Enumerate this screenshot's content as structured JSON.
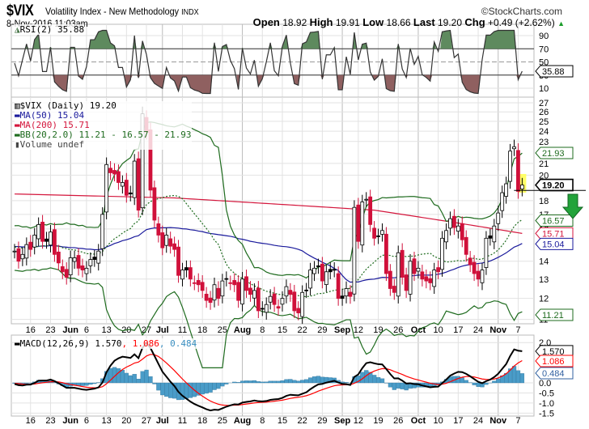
{
  "header": {
    "symbol": "$VIX",
    "name": "Volatility Index - New Methodology",
    "exchange": "INDX",
    "copyright": "©StockCharts.com",
    "datetime": "8-Nov-2016 11:03am",
    "open_label": "Open",
    "open": "18.92",
    "high_label": "High",
    "high": "19.91",
    "low_label": "Low",
    "low": "18.66",
    "last_label": "Last",
    "last": "19.20",
    "chg_label": "Chg",
    "chg": "+0.49 (+2.62%)",
    "chg_arrow": "▲"
  },
  "legends": {
    "rsi": "RSI(2) 35.88",
    "price": "$VIX (Daily) 19.20",
    "ma50": "MA(50) 15.04",
    "ma200": "MA(200) 15.71",
    "bb": "BB(20,2.0) 11.21 - 16.57 - 21.93",
    "volume": "Volume undef",
    "macd": "MACD(12,26,9) 1.570",
    "macd_signal": ", 1.086",
    "macd_hist": ", 0.484"
  },
  "colors": {
    "up": "#ffffff",
    "down": "#d0103a",
    "ma50": "#1a1a9c",
    "ma200": "#d4163c",
    "bb": "#1e6b1e",
    "rsi_hi": "#5e8a5e",
    "rsi_lo": "#8f6060",
    "macd": "#000000",
    "signal": "#ff0000",
    "hist": "#4a9cc8",
    "arrow": "#22a33a"
  },
  "chart_data": {
    "type": "candlestick",
    "title": "$VIX (Daily)",
    "closes": [
      14.6,
      14.0,
      14.4,
      15.0,
      14.7,
      15.6,
      16.3,
      15.2,
      15.2,
      15.8,
      14.4,
      13.9,
      13.4,
      13.1,
      14.2,
      14.2,
      13.6,
      13.5,
      13.6,
      14.1,
      14.1,
      14.6,
      17.0,
      20.9,
      20.2,
      20.1,
      19.4,
      19.4,
      18.4,
      18.5,
      21.2,
      17.3,
      25.8,
      23.9,
      18.8,
      16.6,
      15.6,
      14.8,
      15.6,
      14.9,
      14.7,
      13.2,
      13.5,
      13.5,
      13.0,
      12.8,
      12.7,
      12.4,
      11.9,
      11.8,
      12.7,
      12.0,
      12.9,
      13.0,
      12.8,
      12.7,
      11.9,
      13.0,
      12.4,
      12.2,
      12.4,
      11.4,
      11.5,
      11.7,
      12.1,
      11.7,
      11.6,
      12.0,
      12.6,
      12.2,
      11.4,
      11.3,
      12.3,
      12.4,
      13.5,
      13.6,
      13.7,
      12.9,
      13.4,
      13.4,
      13.5,
      12.0,
      12.0,
      12.5,
      12.1,
      17.5,
      15.2,
      17.9,
      18.1,
      16.3,
      15.4,
      15.5,
      15.9,
      13.3,
      12.5,
      12.3,
      14.5,
      13.1,
      12.4,
      14.0,
      13.3,
      13.6,
      13.0,
      12.9,
      12.8,
      13.5,
      13.4,
      15.4,
      15.9,
      16.7,
      16.1,
      16.2,
      15.3,
      14.4,
      13.8,
      13.3,
      13.0,
      13.5,
      15.4,
      15.4,
      16.2,
      17.1,
      18.6,
      19.3,
      22.1,
      22.5,
      18.7,
      19.2
    ],
    "ma200_knots": [
      [
        0,
        18.5
      ],
      [
        40,
        18.2
      ],
      [
        90,
        17.3
      ],
      [
        127,
        15.71
      ]
    ],
    "date_ticks": [
      {
        "label": "16",
        "i": 4
      },
      {
        "label": "23",
        "i": 9
      },
      {
        "label": "Jun",
        "i": 14,
        "bold": true
      },
      {
        "label": "6",
        "i": 18
      },
      {
        "label": "13",
        "i": 23
      },
      {
        "label": "20",
        "i": 28
      },
      {
        "label": "27",
        "i": 33
      },
      {
        "label": "Jul",
        "i": 37,
        "bold": true
      },
      {
        "label": "11",
        "i": 42
      },
      {
        "label": "18",
        "i": 47
      },
      {
        "label": "25",
        "i": 52
      },
      {
        "label": "Aug",
        "i": 57,
        "bold": true
      },
      {
        "label": "8",
        "i": 62
      },
      {
        "label": "15",
        "i": 67
      },
      {
        "label": "22",
        "i": 72
      },
      {
        "label": "29",
        "i": 77
      },
      {
        "label": "Sep",
        "i": 82,
        "bold": true
      },
      {
        "label": "12",
        "i": 86
      },
      {
        "label": "19",
        "i": 91
      },
      {
        "label": "26",
        "i": 96
      },
      {
        "label": "Oct",
        "i": 101,
        "bold": true
      },
      {
        "label": "10",
        "i": 106
      },
      {
        "label": "17",
        "i": 111
      },
      {
        "label": "24",
        "i": 116
      },
      {
        "label": "Nov",
        "i": 121,
        "bold": true
      },
      {
        "label": "7",
        "i": 126
      }
    ],
    "price_ticks": [
      27,
      26,
      25,
      24,
      23,
      21,
      20,
      18,
      17,
      16,
      14,
      13,
      12,
      11
    ],
    "price_tags": [
      {
        "v": 21.93,
        "label": "21.93",
        "c": "#1e6b1e"
      },
      {
        "v": 19.2,
        "label": "19.20",
        "c": "#000000",
        "bold": true
      },
      {
        "v": 16.57,
        "label": "16.57",
        "c": "#1e6b1e"
      },
      {
        "v": 15.71,
        "label": "15.71",
        "c": "#d4163c"
      },
      {
        "v": 15.04,
        "label": "15.04",
        "c": "#1a1a9c"
      },
      {
        "v": 11.21,
        "label": "11.21",
        "c": "#1e6b1e"
      }
    ],
    "rsi_ticks": [
      90,
      70,
      50,
      30,
      10
    ],
    "rsi_tag": {
      "v": 35.88,
      "label": "35.88"
    },
    "macd_ticks": [
      {
        "v": 2.0,
        "label": "2.0"
      },
      {
        "v": 0.0,
        "label": "0.0"
      },
      {
        "v": -0.5,
        "label": "-0.5"
      },
      {
        "v": -1.0,
        "label": "-1.0"
      },
      {
        "v": -1.5,
        "label": "-1.5"
      }
    ],
    "macd_tags": [
      {
        "v": 1.57,
        "label": "1.570",
        "c": "#000000"
      },
      {
        "v": 1.086,
        "label": "1.086",
        "c": "#ff0000"
      },
      {
        "v": 0.484,
        "label": "0.484",
        "c": "#3060a0"
      }
    ]
  }
}
